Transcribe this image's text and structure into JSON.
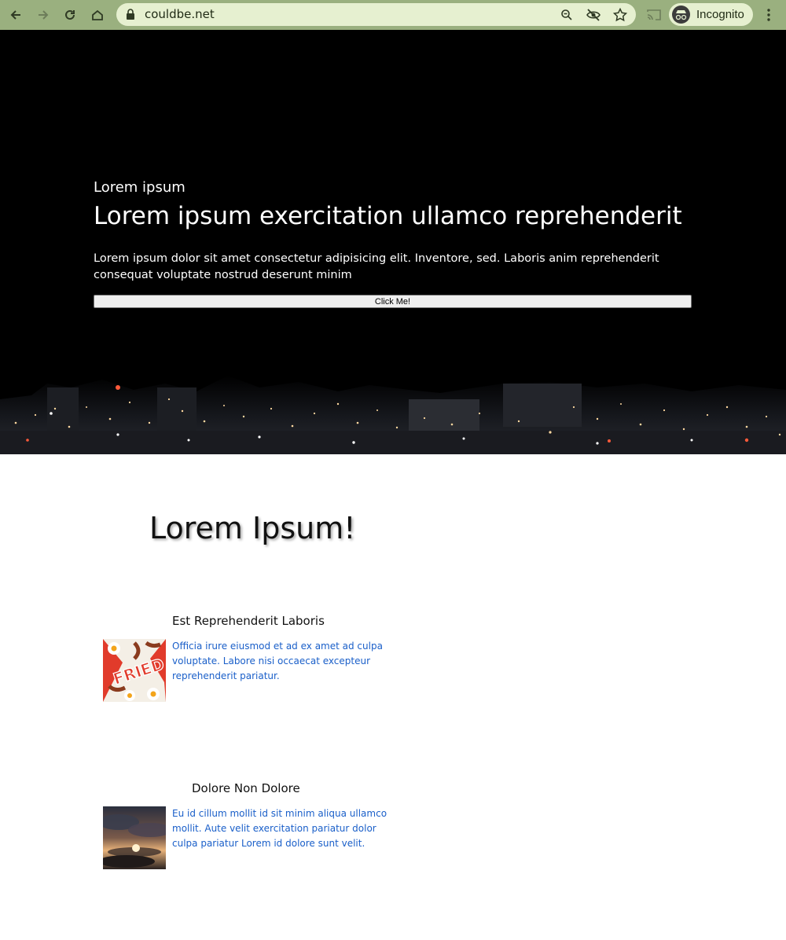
{
  "browser": {
    "url": "couldbe.net",
    "profile_label": "Incognito",
    "icons": [
      "back-icon",
      "forward-icon",
      "reload-icon",
      "home-icon",
      "lock-icon",
      "zoom-icon",
      "eye-off-icon",
      "star-icon",
      "cast-icon",
      "incognito-icon",
      "menu-icon"
    ]
  },
  "hero": {
    "eyebrow": "Lorem ipsum",
    "title": "Lorem ipsum exercitation ullamco reprehenderit",
    "text": "Lorem ipsum dolor sit amet consectetur adipisicing elit. Inventore, sed. Laboris anim reprehenderit consequat voluptate nostrud deserunt minim",
    "button_label": "Click Me!"
  },
  "section": {
    "title": "Lorem Ipsum!"
  },
  "cards": [
    {
      "title": "Est Reprehenderit Laboris",
      "text": "Officia irure eiusmod et ad ex amet ad culpa voluptate. Labore nisi occaecat excepteur reprehenderit pariatur.",
      "image_label": "FRIED"
    },
    {
      "title": "Dolore Non Dolore",
      "text": "Eu id cillum mollit id sit minim aliqua ullamco mollit. Aute velit exercitation pariatur dolor culpa pariatur Lorem id dolore sunt velit."
    }
  ],
  "colors": {
    "chrome": "#9ab07f",
    "omnibox": "#e6f0d0",
    "link_text": "#1a5fc9",
    "hero_bg": "#000000"
  }
}
